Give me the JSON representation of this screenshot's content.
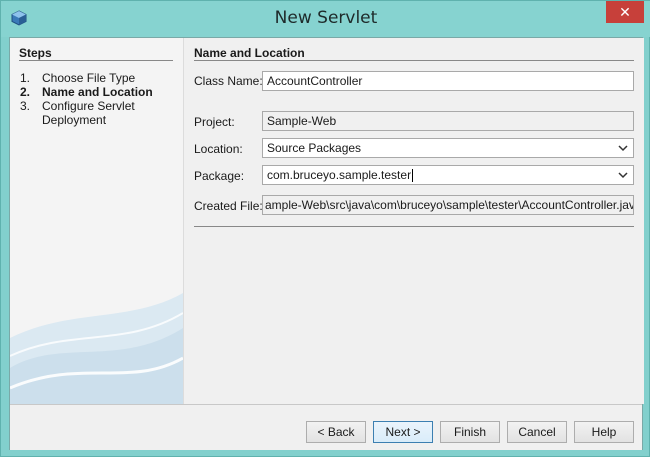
{
  "window": {
    "title": "New Servlet",
    "close_label": "✕"
  },
  "steps": {
    "title": "Steps",
    "items": [
      {
        "num": "1.",
        "label": "Choose File Type",
        "active": false
      },
      {
        "num": "2.",
        "label": "Name and Location",
        "active": true
      },
      {
        "num": "3.",
        "label": "Configure Servlet",
        "active": false
      },
      {
        "num": "",
        "label": "Deployment",
        "active": false
      }
    ]
  },
  "form": {
    "section_title": "Name and Location",
    "class_name": {
      "label": "Class Name:",
      "value": "AccountController"
    },
    "project": {
      "label": "Project:",
      "value": "Sample-Web"
    },
    "location": {
      "label": "Location:",
      "value": "Source Packages"
    },
    "package": {
      "label": "Package:",
      "value": "com.bruceyo.sample.tester"
    },
    "created_file": {
      "label": "Created File:",
      "value": "ample-Web\\src\\java\\com\\bruceyo\\sample\\tester\\AccountController.java"
    }
  },
  "buttons": {
    "back": "< Back",
    "next": "Next >",
    "finish": "Finish",
    "cancel": "Cancel",
    "help": "Help"
  },
  "colors": {
    "titlebar": "#86d3d0",
    "close": "#c7403a",
    "default_button_border": "#3c7fb1"
  }
}
